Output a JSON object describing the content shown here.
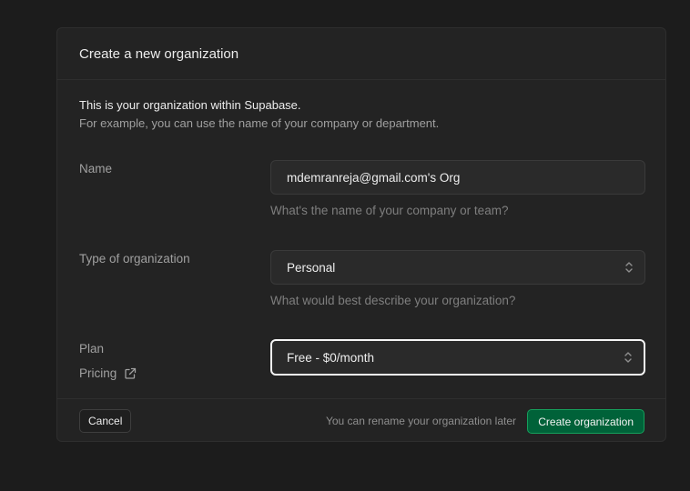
{
  "dialog": {
    "title": "Create a new organization",
    "intro_line1": "This is your organization within Supabase.",
    "intro_line2": "For example, you can use the name of your company or department."
  },
  "form": {
    "name": {
      "label": "Name",
      "value": "mdemranreja@gmail.com's Org",
      "hint": "What's the name of your company or team?"
    },
    "type": {
      "label": "Type of organization",
      "selected": "Personal",
      "hint": "What would best describe your organization?"
    },
    "plan": {
      "label": "Plan",
      "selected": "Free - $0/month",
      "pricing_link": "Pricing"
    }
  },
  "footer": {
    "cancel_label": "Cancel",
    "note": "You can rename your organization later",
    "create_label": "Create organization"
  },
  "colors": {
    "background": "#1c1c1c",
    "card": "#232323",
    "primary_button": "#006239",
    "primary_border": "#16a05c"
  },
  "icons": {
    "select_chevron": "chevrons-up-down-icon",
    "external_link": "external-link-icon"
  }
}
